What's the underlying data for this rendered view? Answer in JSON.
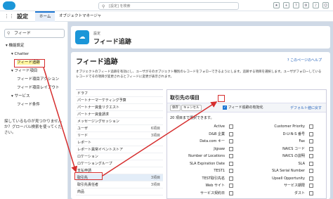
{
  "header": {
    "search_placeholder": "[設定] を検索",
    "icons": [
      "star-icon",
      "plus-icon",
      "help-icon",
      "gear-icon",
      "bell-icon",
      "avatar-icon"
    ]
  },
  "nav": {
    "app_name": "設定",
    "tabs": [
      "ホーム",
      "オブジェクトマネージャ"
    ]
  },
  "sidebar": {
    "quick_find": "フィード",
    "tree": [
      {
        "label": "機能設定",
        "indent": 0,
        "hl": ""
      },
      {
        "label": "Chatter",
        "indent": 1,
        "hl": ""
      },
      {
        "label": "フィード追跡",
        "indent": 2,
        "hl": "all"
      },
      {
        "label": "フィード項目",
        "indent": 1,
        "hl": "part"
      },
      {
        "label": "フィード項目アクション",
        "indent": 2,
        "hl": "part"
      },
      {
        "label": "フィード項目レイアウト",
        "indent": 2,
        "hl": "part"
      },
      {
        "label": "サービス",
        "indent": 1,
        "hl": ""
      },
      {
        "label": "フィード条件",
        "indent": 2,
        "hl": "part"
      }
    ],
    "no_result_text": "探しているものが見つかりませんか？グローバル検索を使ってください。"
  },
  "main": {
    "breadcrumb": "設定",
    "title": "フィード追跡",
    "panel_title": "フィード追跡",
    "help_link": "このページのヘルプ",
    "description": "オブジェクトのフィード追跡を有効にし、ユーザがそのオブジェクト種別のレコードをフォローできるようにします。追跡する項目を選択します。ユーザがフォローしているレコードでその項目が変更されるとフィードに変更が表示されます。",
    "objects": [
      {
        "name": "ドラフ",
        "count": ""
      },
      {
        "name": "パートナーマーケティング予算",
        "count": ""
      },
      {
        "name": "パートナー資金リクエスト",
        "count": ""
      },
      {
        "name": "パートナー資金請求",
        "count": ""
      },
      {
        "name": "メッセージングセッション",
        "count": ""
      },
      {
        "name": "ユーザ",
        "count": "6項目"
      },
      {
        "name": "リード",
        "count": "3項目"
      },
      {
        "name": "レポート",
        "count": ""
      },
      {
        "name": "レポート異常イベントストア",
        "count": ""
      },
      {
        "name": "ロケーション",
        "count": ""
      },
      {
        "name": "ロケーショングループ",
        "count": ""
      },
      {
        "name": "支払申請",
        "count": ""
      },
      {
        "name": "取引先",
        "count": "3項目"
      },
      {
        "name": "取引先責任者",
        "count": "3項目"
      },
      {
        "name": "商品",
        "count": ""
      }
    ],
    "selected_object_index": 12,
    "fields_box": {
      "title": "取引先の項目",
      "save": "保存",
      "cancel": "キャンセル",
      "enable_label": "フィード追跡の有効化",
      "default_link": "デフォルト値に戻す",
      "limit_text": "20 項目まで選択できます。",
      "left_fields": [
        "Active",
        "D&B 企業",
        "Data.com キー",
        "Jigsaw",
        "Number of Locations",
        "SLA Expiration Date",
        "TEST1",
        "TEST取引先名",
        "Web サイト",
        "サービス契約日"
      ],
      "right_fields": [
        "Customer Priority",
        "D-U-N-S 番号",
        "Fax",
        "NAICS コード",
        "NAICS の説明",
        "SLA",
        "SLA Serial Number",
        "Upsell Opportunity",
        "サービス期限",
        "ダスト"
      ]
    }
  },
  "colors": {
    "accent": "#1b76d3",
    "annotation": "#d62e2e",
    "highlight": "#fff59c"
  }
}
